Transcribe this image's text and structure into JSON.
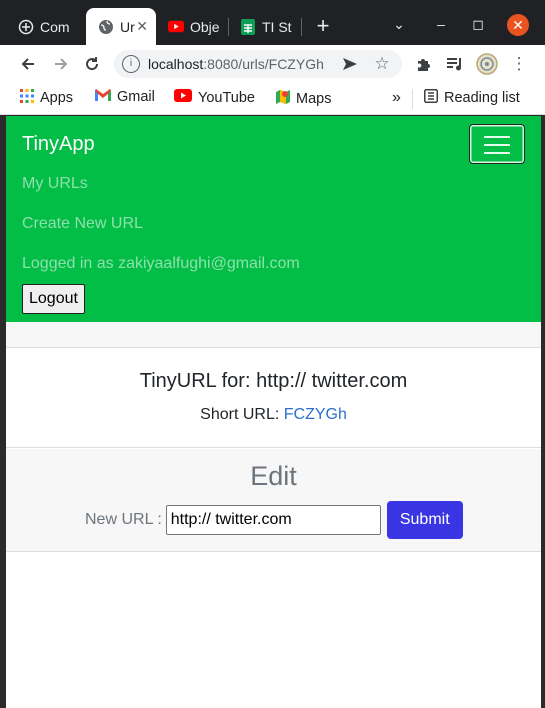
{
  "browser": {
    "tabs": [
      {
        "label": "Com",
        "icon": "globe-plus-icon",
        "active": false
      },
      {
        "label": "Ur",
        "icon": "globe-icon",
        "active": true
      },
      {
        "label": "Obje",
        "icon": "youtube-icon",
        "active": false
      },
      {
        "label": "TI St",
        "icon": "sheets-icon",
        "active": false
      }
    ],
    "address_host": "localhost",
    "address_path": ":8080/urls/FCZYGh",
    "bookmarks": [
      {
        "label": "Apps",
        "icon": "apps-grid-icon"
      },
      {
        "label": "Gmail",
        "icon": "gmail-icon"
      },
      {
        "label": "YouTube",
        "icon": "youtube-icon"
      },
      {
        "label": "Maps",
        "icon": "maps-icon"
      }
    ],
    "more_bookmarks": "»",
    "reading_list": "Reading list"
  },
  "navbar": {
    "brand": "TinyApp",
    "links": [
      "My URLs",
      "Create New URL",
      "Logged in as zakiyaalfughi@gmail.com"
    ],
    "logout_label": "Logout"
  },
  "card": {
    "title": "TinyURL for: http:// twitter.com",
    "short_label": "Short URL:",
    "short_code": "FCZYGh"
  },
  "edit": {
    "heading": "Edit",
    "new_url_label": "New URL :",
    "new_url_value": "http:// twitter.com",
    "submit_label": "Submit"
  },
  "colors": {
    "navbar": "#02bd46",
    "submit": "#3a35e3",
    "link": "#2c6fd1"
  }
}
